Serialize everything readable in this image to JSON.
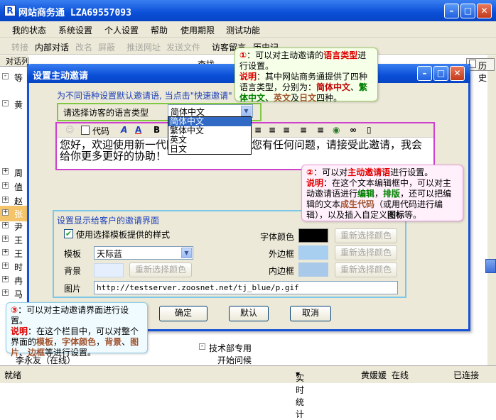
{
  "window": {
    "title": "网站商务通  LZA69557093",
    "app_icon": "R"
  },
  "menu": [
    "我的状态",
    "系统设置",
    "个人设置",
    "帮助",
    "使用期限",
    "测试功能"
  ],
  "toolbar": [
    "转接",
    "内部对话",
    "改名",
    "屏蔽",
    "推送网址",
    "发送文件",
    "访客留言",
    "历史记"
  ],
  "left_panel": {
    "header": "对话列表",
    "items": [
      {
        "pm": "-",
        "label": "等"
      },
      {
        "pm": "",
        "label": ""
      },
      {
        "pm": "-",
        "label": "黄"
      },
      {
        "pm": "",
        "label": ""
      },
      {
        "pm": "",
        "label": ""
      },
      {
        "pm": "",
        "label": ""
      },
      {
        "pm": "",
        "label": ""
      },
      {
        "pm": "+",
        "label": "周"
      },
      {
        "pm": "+",
        "label": "值"
      },
      {
        "pm": "+",
        "label": "赵"
      },
      {
        "pm": "+",
        "label": "张"
      },
      {
        "pm": "+",
        "label": "尹"
      },
      {
        "pm": "+",
        "label": "王"
      },
      {
        "pm": "+",
        "label": "王"
      },
      {
        "pm": "+",
        "label": "时"
      },
      {
        "pm": "+",
        "label": "冉"
      },
      {
        "pm": "+",
        "label": "马"
      }
    ],
    "bottom_item": "李永友（在线）"
  },
  "right_strip": {
    "find_label": "查找",
    "history_tab": "历史"
  },
  "bottom_tree": {
    "group": "技术部专用",
    "item": "开始问候"
  },
  "status": {
    "ready": "就绪",
    "stats": "实时统计",
    "agent": "黄媛媛",
    "state": "在线",
    "connection": "已连接"
  },
  "dialog": {
    "title": "设置主动邀请",
    "hint": "为不同语种设置默认邀请语, 当点击\"快速邀请\"",
    "lang_label": "请选择访客的语言类型",
    "lang_selected": "简体中文",
    "lang_options": [
      "简体中文",
      "繁体中文",
      "英文",
      "日文"
    ],
    "editor": {
      "code_label": "代码",
      "text": "您好，欢迎使用新一代网站商务通！如果您有任何问题，请接受此邀请，我会给你更多更好的协助！"
    },
    "settings": {
      "title": "设置显示给客户的邀请界面",
      "use_template_label": "使用选择模板提供的样式",
      "use_template_checked": true,
      "template_label": "模板",
      "template_value": "天际蓝",
      "background_label": "背景",
      "image_label": "图片",
      "image_value": "http://testserver.zoosnet.net/tj_blue/p.gif",
      "font_color_label": "字体颜色",
      "outer_border_label": "外边框",
      "inner_border_label": "内边框",
      "reselect_color": "重新选择颜色",
      "colors": {
        "font": "#000000",
        "outer": "#a8cef0",
        "inner": "#a9c9ea",
        "background": "#e4eefc"
      }
    },
    "buttons": {
      "ok": "确定",
      "default": "默认",
      "cancel": "取消"
    }
  },
  "callouts": {
    "c1": {
      "num": "①",
      "a": "：可以对主动邀请的",
      "b": "语言类型",
      "c": "进行设置。",
      "d": "说明",
      "e": "：其中网站商务通提供了四种语言类型，分别为：",
      "f": "简体中文",
      "g": "、",
      "h": "繁体中文",
      "i": "、",
      "j": "英文",
      "k": "及",
      "l": "日文",
      "m": "四种。"
    },
    "c2": {
      "num": "②",
      "a": "：可以对",
      "b": "主动邀请语",
      "c": "进行设置。",
      "d": "说明",
      "e": "：在这个文本编辑框中，可以对主动邀请语进行",
      "f": "编辑",
      "g": "，",
      "h": "排版",
      "i": "，还可以把编辑的文本",
      "j": "成生代码",
      "k": "（或用代码进行编辑），以及插入自定义",
      "l": "图标",
      "m": "等。"
    },
    "c3": {
      "num": "③",
      "a": "：可以对主动邀请界面进行设置。",
      "d": "说明",
      "e": "：在这个栏目中，可以对整个界面的",
      "f": "模板",
      "g": "，",
      "h": "字体颜色",
      "i": "，",
      "j": "背景",
      "k": "、",
      "l": "图片",
      "m": "、",
      "n": "边框",
      "o": "等进行设置。"
    }
  }
}
